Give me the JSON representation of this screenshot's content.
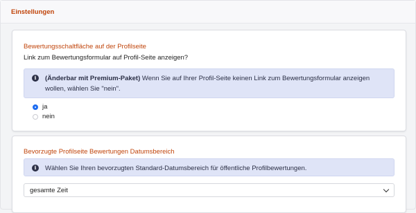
{
  "panel": {
    "title": "Einstellungen"
  },
  "rating_button": {
    "title": "Bewertungsschaltfläche auf der Profilseite",
    "question": "Link zum Bewertungsformular auf Profil-Seite anzeigen?",
    "info_icon": "info-icon",
    "info_bold": "(Änderbar mit Premium-Paket)",
    "info_text": " Wenn Sie auf Ihrer Profil-Seite keinen Link zum Bewertungsformular anzeigen wollen, wählen Sie \"nein\".",
    "options": [
      {
        "label": "ja",
        "checked": true
      },
      {
        "label": "nein",
        "checked": false
      }
    ]
  },
  "date_range": {
    "title": "Bevorzugte Profilseite Bewertungen Datumsbereich",
    "info_icon": "info-icon",
    "info_text": "Wählen Sie Ihren bevorzugten Standard-Datumsbereich für öffentliche Profilbewertungen.",
    "select_value": "gesamte Zeit"
  },
  "colors": {
    "accent": "#c0440a",
    "info_bg": "#dfe4f7",
    "radio_selected": "#1e6cf0"
  }
}
